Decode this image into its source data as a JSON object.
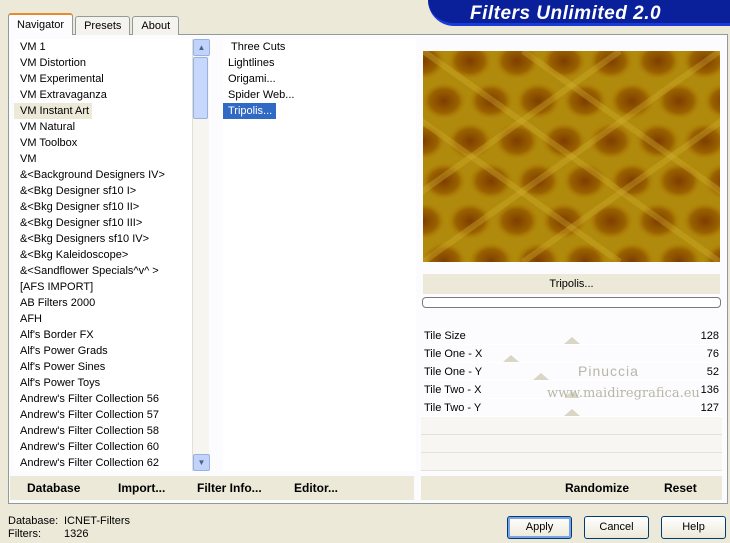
{
  "tabs": [
    "Navigator",
    "Presets",
    "About"
  ],
  "banner_title": "Filters Unlimited 2.0",
  "categories": [
    "VM 1",
    "VM Distortion",
    "VM Experimental",
    "VM Extravaganza",
    "VM Instant Art",
    "VM Natural",
    "VM Toolbox",
    "VM",
    "&<Background Designers IV>",
    "&<Bkg Designer sf10 I>",
    "&<Bkg Designer sf10 II>",
    "&<Bkg Designer sf10 III>",
    "&<Bkg Designers sf10 IV>",
    "&<Bkg Kaleidoscope>",
    "&<Sandflower Specials^v^ >",
    "[AFS IMPORT]",
    "AB Filters 2000",
    "AFH",
    "Alf's Border FX",
    "Alf's Power Grads",
    "Alf's Power Sines",
    "Alf's Power Toys",
    "Andrew's Filter Collection 56",
    "Andrew's Filter Collection 57",
    "Andrew's Filter Collection 58",
    "Andrew's Filter Collection 60",
    "Andrew's Filter Collection 62"
  ],
  "selected_category": "VM Instant Art",
  "filters": [
    "Three Cuts",
    "Lightlines",
    "Origami...",
    "Spider Web...",
    "Tripolis..."
  ],
  "selected_filter": "Tripolis...",
  "preview": {
    "filter_name": "Tripolis..."
  },
  "params": [
    {
      "label": "Tile Size",
      "value": "128"
    },
    {
      "label": "Tile One - X",
      "value": "76"
    },
    {
      "label": "Tile One - Y",
      "value": "52"
    },
    {
      "label": "Tile Two - X",
      "value": "136"
    },
    {
      "label": "Tile Two - Y",
      "value": "127"
    }
  ],
  "watermark": {
    "line1": "Pinuccia",
    "line2": "www.maidiregrafica.eu"
  },
  "bottom_links": {
    "database": "Database",
    "import": "Import...",
    "filter_info": "Filter Info...",
    "editor": "Editor...",
    "randomize": "Randomize",
    "reset": "Reset"
  },
  "status": {
    "database_label": "Database:",
    "database_value": "ICNET-Filters",
    "filters_label": "Filters:",
    "filters_value": "1326"
  },
  "buttons": {
    "apply": "Apply",
    "cancel": "Cancel",
    "help": "Help"
  },
  "colors": {
    "banner": "#0a1f9a",
    "selection": "#316ac5",
    "preview_gold": "#b8900a",
    "preview_brown": "#8a4a00"
  }
}
